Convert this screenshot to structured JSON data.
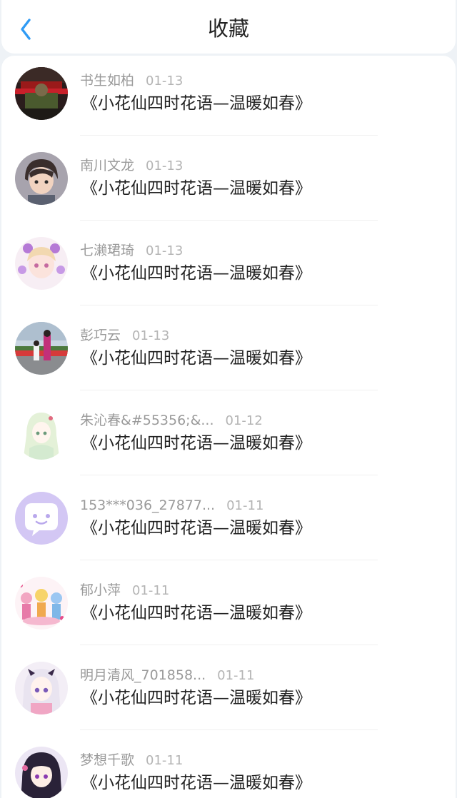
{
  "header": {
    "title": "收藏",
    "back_icon": "chevron-left-icon",
    "accent_color": "#2f9bf5"
  },
  "favorites": [
    {
      "user": "书生如柏",
      "date": "01-13",
      "work": "《小花仙四时花语—温暖如春》"
    },
    {
      "user": "南川文龙",
      "date": "01-13",
      "work": "《小花仙四时花语—温暖如春》"
    },
    {
      "user": "七濑珺琦",
      "date": "01-13",
      "work": "《小花仙四时花语—温暖如春》"
    },
    {
      "user": "彭巧云",
      "date": "01-13",
      "work": "《小花仙四时花语—温暖如春》"
    },
    {
      "user": "朱沁春&#55356;&...",
      "date": "01-12",
      "work": "《小花仙四时花语—温暖如春》"
    },
    {
      "user": "153***036_27877...",
      "date": "01-11",
      "work": "《小花仙四时花语—温暖如春》"
    },
    {
      "user": "郁小萍",
      "date": "01-11",
      "work": "《小花仙四时花语—温暖如春》"
    },
    {
      "user": "明月清风_701858...",
      "date": "01-11",
      "work": "《小花仙四时花语—温暖如春》"
    },
    {
      "user": "梦想千歌",
      "date": "01-11",
      "work": "《小花仙四时花语—温暖如春》"
    }
  ]
}
